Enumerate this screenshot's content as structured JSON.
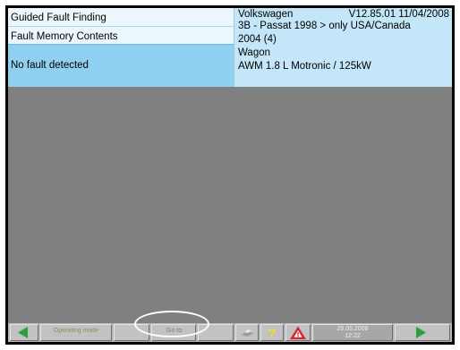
{
  "header": {
    "left": {
      "title": "Guided Fault Finding",
      "subtitle": "Fault Memory Contents",
      "status": "No fault detected"
    },
    "right": {
      "make": "Volkswagen",
      "version": "V12.85.01 11/04/2008",
      "model": "3B - Passat 1998 > only USA/Canada",
      "year": "2004 (4)",
      "body": "Wagon",
      "engine": "AWM 1.8 L Motronic / 125kW"
    }
  },
  "toolbar": {
    "operating_mode_label": "Operating mode",
    "goto_label": "Go to",
    "date": "26.05.2008",
    "time": "12:22"
  },
  "colors": {
    "header_light": "#ecf7fd",
    "header_selected": "#8fd0f0",
    "main_background": "#808080",
    "nav_arrow": "#2e9e3c",
    "help_icon": "#f6e11a",
    "warning_icon": "#d8262d"
  },
  "icons": [
    "back-arrow-icon",
    "print-icon",
    "help-icon",
    "warning-icon",
    "forward-arrow-icon"
  ]
}
